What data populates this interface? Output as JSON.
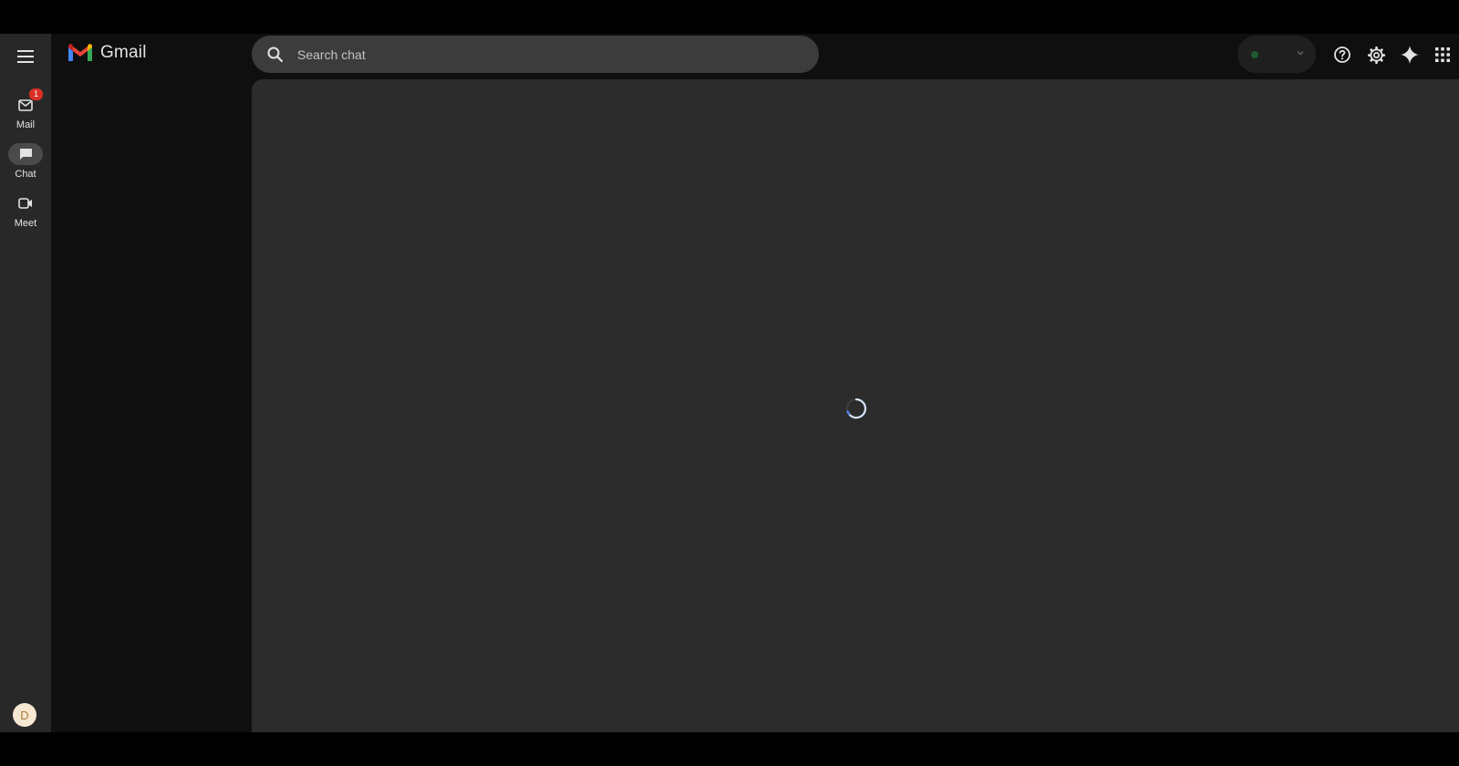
{
  "app": {
    "name": "Gmail"
  },
  "rail": {
    "items": [
      {
        "label": "Mail",
        "icon": "mail-icon",
        "badge": "1",
        "active": false
      },
      {
        "label": "Chat",
        "icon": "chat-icon",
        "active": true
      },
      {
        "label": "Meet",
        "icon": "video-icon",
        "active": false
      }
    ],
    "avatar": {
      "initial": "D"
    }
  },
  "search": {
    "placeholder": "Search chat",
    "value": ""
  },
  "header": {
    "icons": [
      "help-icon",
      "gear-icon",
      "gemini-sparkle-icon",
      "apps-grid-icon"
    ],
    "status_color": "#1e5a2f"
  },
  "main": {
    "state": "loading"
  },
  "colors": {
    "rail_bg": "#282828",
    "main_bg": "#2c2c2c",
    "search_bg": "#3c3c3c",
    "accent": "#8ab4f8"
  }
}
